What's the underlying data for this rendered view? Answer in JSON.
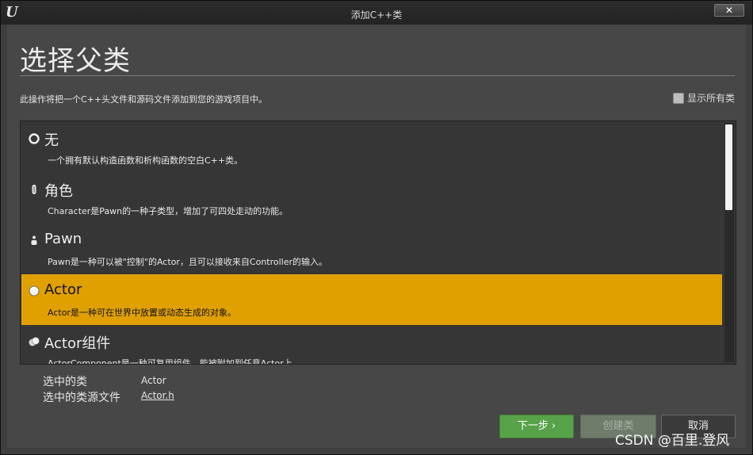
{
  "window": {
    "title": "添加C++类",
    "close_label": "✕"
  },
  "page": {
    "heading": "选择父类",
    "description": "此操作将把一个C++头文件和源码文件添加到您的游戏项目中。",
    "show_all_label": "显示所有类"
  },
  "classes": [
    {
      "name": "无",
      "description": "一个拥有默认构造函数和析构函数的空白C++类。",
      "icon": "empty-circle-icon"
    },
    {
      "name": "角色",
      "description": "Character是Pawn的一种子类型，增加了可四处走动的功能。",
      "icon": "character-icon"
    },
    {
      "name": "Pawn",
      "description": "Pawn是一种可以被\"控制\"的Actor，且可以接收来自Controller的输入。",
      "icon": "pawn-icon"
    },
    {
      "name": "Actor",
      "description": "Actor是一种可在世界中放置或动态生成的对象。",
      "icon": "actor-sphere-icon",
      "selected": true
    },
    {
      "name": "Actor组件",
      "description": "ActorComponent是一种可复用组件，能被附加到任意Actor上",
      "icon": "actor-component-icon"
    }
  ],
  "selection": {
    "class_label": "选中的类",
    "class_value": "Actor",
    "source_label": "选中的类源文件",
    "source_value": "Actor.h"
  },
  "buttons": {
    "next": "下一步 ›",
    "create": "创建类",
    "cancel": "取消"
  },
  "watermark": "CSDN @百里.登风",
  "colors": {
    "selected_row": "#e0a000",
    "next_button": "#58a34a"
  }
}
